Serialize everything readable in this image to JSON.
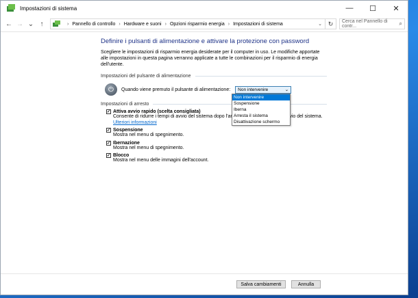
{
  "window": {
    "title": "Impostazioni di sistema",
    "controls": {
      "minimize": "—",
      "maximize": "☐",
      "close": "✕"
    }
  },
  "nav": {
    "back": "←",
    "forward": "→",
    "dropdown": "⌄",
    "up": "↑",
    "breadcrumbs": [
      "Pannello di controllo",
      "Hardware e suoni",
      "Opzioni risparmio energia",
      "Impostazioni di sistema"
    ],
    "search_placeholder": "Cerca nel Pannello di contr..."
  },
  "content": {
    "heading": "Definire i pulsanti di alimentazione e attivare la protezione con password",
    "description": "Scegliere le impostazioni di risparmio energia desiderate per il computer in uso. Le modifiche apportate alle impostazioni in questa pagina verranno applicate a tutte le combinazioni per il risparmio di energia dell'utente.",
    "power_section_title": "Impostazioni del pulsante di alimentazione",
    "power_label": "Quando viene premuto il pulsante di alimentazione:",
    "power_selected": "Non intervenire",
    "dropdown_options": [
      "Non intervenire",
      "Sospensione",
      "Iberna",
      "Arresta il sistema",
      "Disattivazione schermo"
    ],
    "shutdown_section_title": "Impostazioni di arresto",
    "options": [
      {
        "title": "Attiva avvio rapido (scelta consigliata)",
        "checked": true,
        "desc": "Consente di ridurre i tempi di avvio del sistema dopo l'arresto. Non influisce sul riavvio del sistema.",
        "link": "Ulteriori informazioni"
      },
      {
        "title": "Sospensione",
        "checked": true,
        "desc": "Mostra nel menu di spegnimento."
      },
      {
        "title": "Ibernazione",
        "checked": true,
        "desc": "Mostra nel menu di spegnimento."
      },
      {
        "title": "Blocco",
        "checked": true,
        "desc": "Mostra nel menu delle immagini dell'account."
      }
    ]
  },
  "footer": {
    "save_label": "Salva cambiamenti",
    "cancel_label": "Annulla"
  }
}
